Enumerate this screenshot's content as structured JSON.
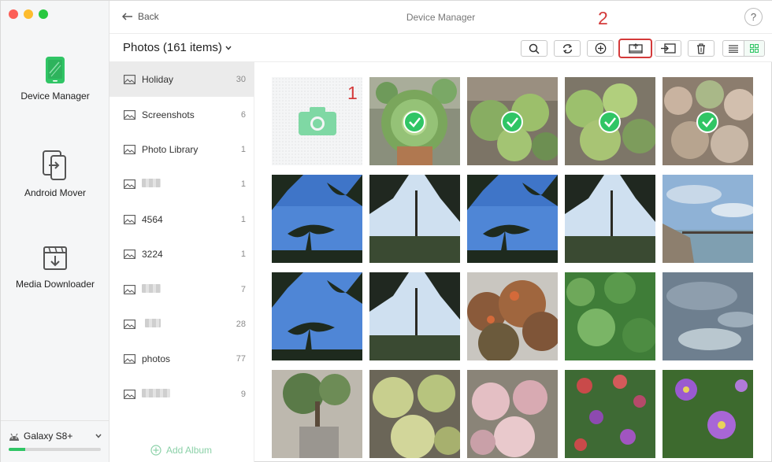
{
  "nav": {
    "items": [
      {
        "label": "Device Manager",
        "icon": "phone-icon"
      },
      {
        "label": "Android Mover",
        "icon": "transfer-icon"
      },
      {
        "label": "Media Downloader",
        "icon": "download-icon"
      }
    ],
    "device": {
      "name": "Galaxy S8+",
      "storage_used": 0.18
    }
  },
  "header": {
    "back_label": "Back",
    "title": "Device Manager",
    "help_label": "?"
  },
  "toolbar": {
    "album_title": "Photos (161 items)"
  },
  "annotations": {
    "step1": "1",
    "step2": "2"
  },
  "albums": [
    {
      "name": "Holiday",
      "count": "30"
    },
    {
      "name": "Screenshots",
      "count": "6"
    },
    {
      "name": "Photo Library",
      "count": "1"
    },
    {
      "name": "",
      "count": "1"
    },
    {
      "name": "4564",
      "count": "1"
    },
    {
      "name": "3224",
      "count": "1"
    },
    {
      "name": "",
      "count": "7"
    },
    {
      "name": "",
      "count": "28"
    },
    {
      "name": "photos",
      "count": "77"
    },
    {
      "name": "",
      "count": "9"
    }
  ],
  "add_album_label": "Add Album",
  "colors": {
    "accent": "#30c565",
    "highlight": "#d43a3a"
  }
}
